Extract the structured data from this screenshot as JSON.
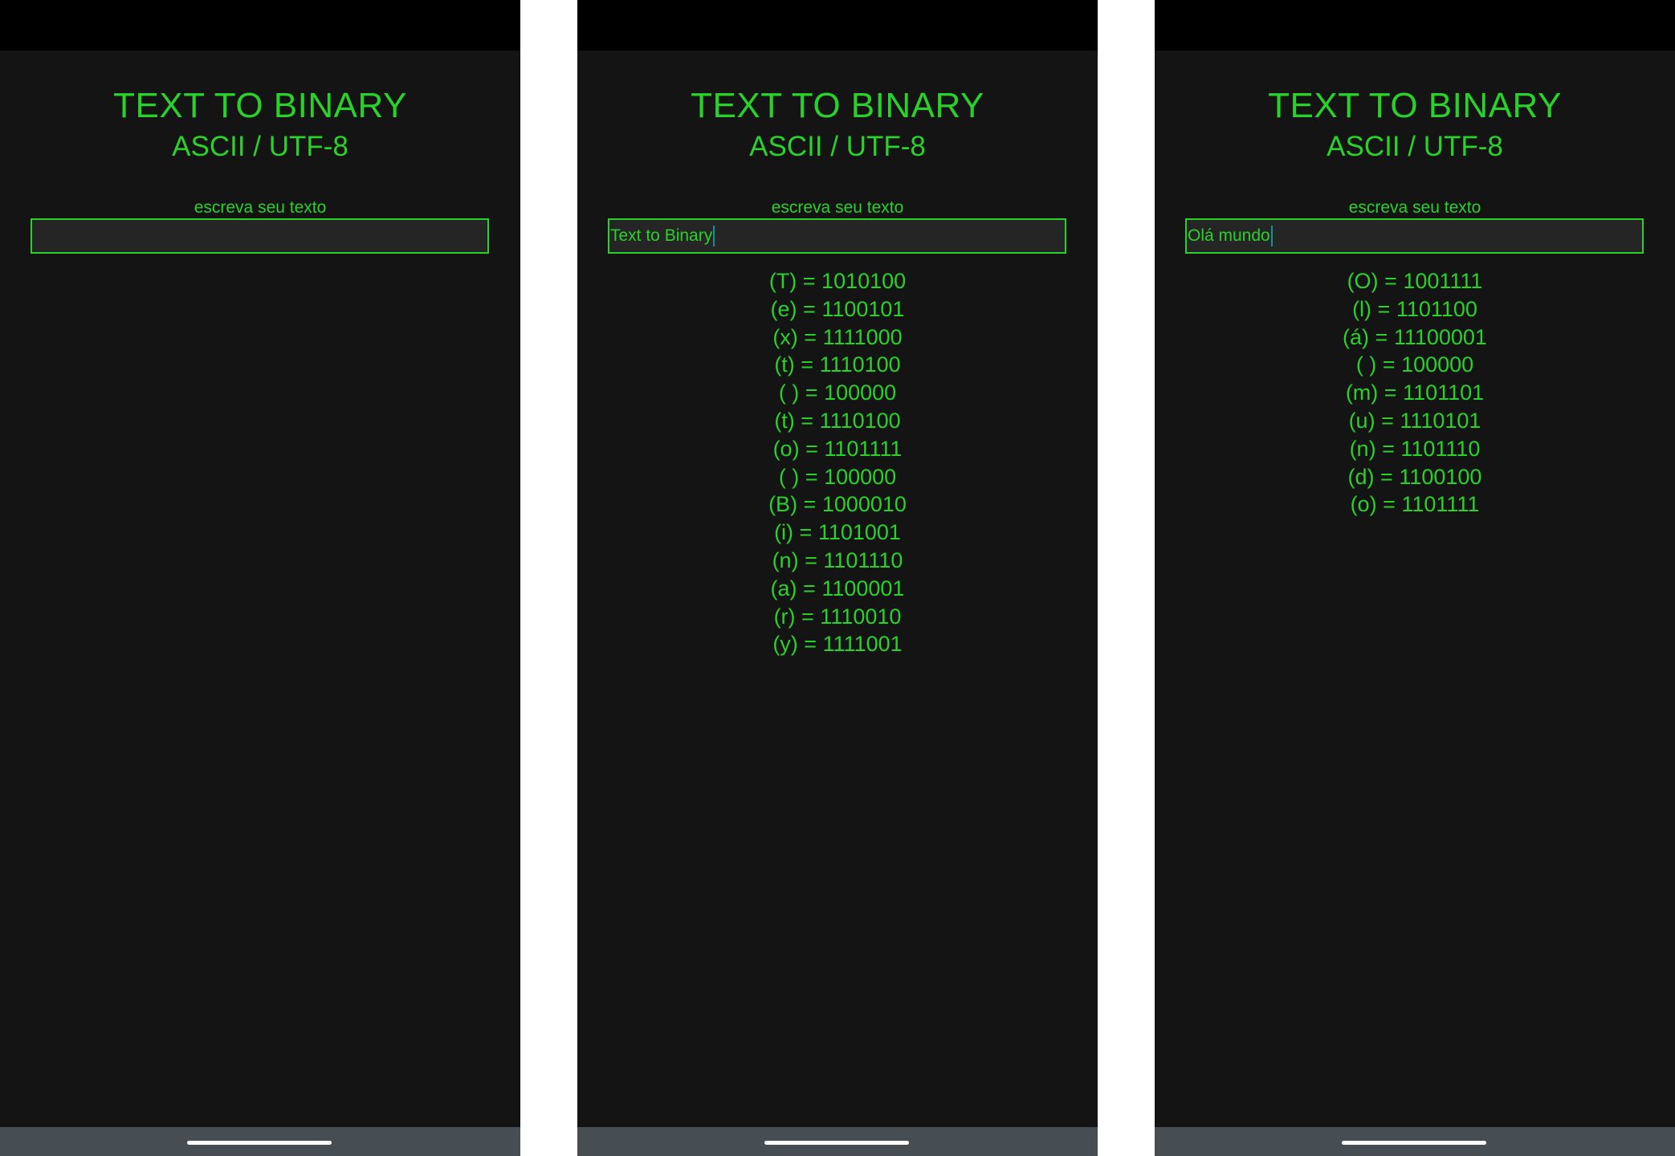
{
  "screens": [
    {
      "title": "TEXT TO BINARY",
      "subtitle": "ASCII / UTF-8",
      "input_label": "escreva seu texto",
      "input_value": "",
      "results": []
    },
    {
      "title": "TEXT TO BINARY",
      "subtitle": "ASCII / UTF-8",
      "input_label": "escreva seu texto",
      "input_value": "Text to Binary",
      "results": [
        "(T) = 1010100",
        "(e) = 1100101",
        "(x) = 1111000",
        "(t) = 1110100",
        "( ) = 100000",
        "(t) = 1110100",
        "(o) = 1101111",
        "( ) = 100000",
        "(B) = 1000010",
        "(i) = 1101001",
        "(n) = 1101110",
        "(a) = 1100001",
        "(r) = 1110010",
        "(y) = 1111001"
      ]
    },
    {
      "title": "TEXT TO BINARY",
      "subtitle": "ASCII / UTF-8",
      "input_label": "escreva seu texto",
      "input_value": "Olá mundo",
      "results": [
        "(O) = 1001111",
        "(l) = 1101100",
        "(á) = 11100001",
        "( ) = 100000",
        "(m) = 1101101",
        "(u) = 1110101",
        "(n) = 1101110",
        "(d) = 1100100",
        "(o) = 1101111"
      ]
    }
  ],
  "colors": {
    "accent": "#2bd12b",
    "background": "#141414",
    "status_bar": "#000000",
    "input_bg": "#252525",
    "nav_bar": "#474e53",
    "caret": "#1a8f9a"
  }
}
